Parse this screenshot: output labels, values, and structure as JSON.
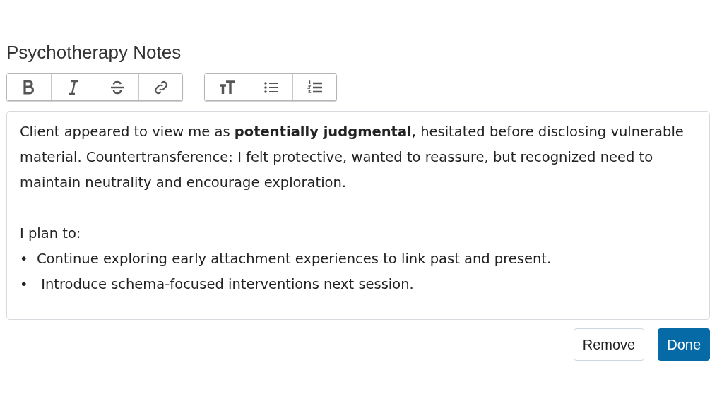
{
  "section_title": "Psychotherapy Notes",
  "toolbar_groups": [
    [
      {
        "kind": "bold"
      },
      {
        "kind": "italic"
      },
      {
        "kind": "strikethrough"
      },
      {
        "kind": "link"
      }
    ],
    [
      {
        "kind": "text-size"
      },
      {
        "kind": "bulleted-list"
      },
      {
        "kind": "numbered-list"
      }
    ]
  ],
  "editor": {
    "paragraphs": [
      "Client appeared to view me as **potentially judgmental**, hesitated before disclosing vulnerable material. Countertransference: I felt protective, wanted to reassure, but recognized need to maintain neutrality and encourage exploration.",
      "I plan to:"
    ],
    "bullets": [
      {
        "marker": "•",
        "text": "Continue exploring early attachment experiences to link past and present."
      },
      {
        "marker": "•",
        "text": " Introduce schema-focused interventions next session."
      }
    ]
  },
  "buttons": [
    {
      "label": "Remove",
      "kind": "secondary"
    },
    {
      "label": "Done",
      "kind": "primary"
    }
  ]
}
